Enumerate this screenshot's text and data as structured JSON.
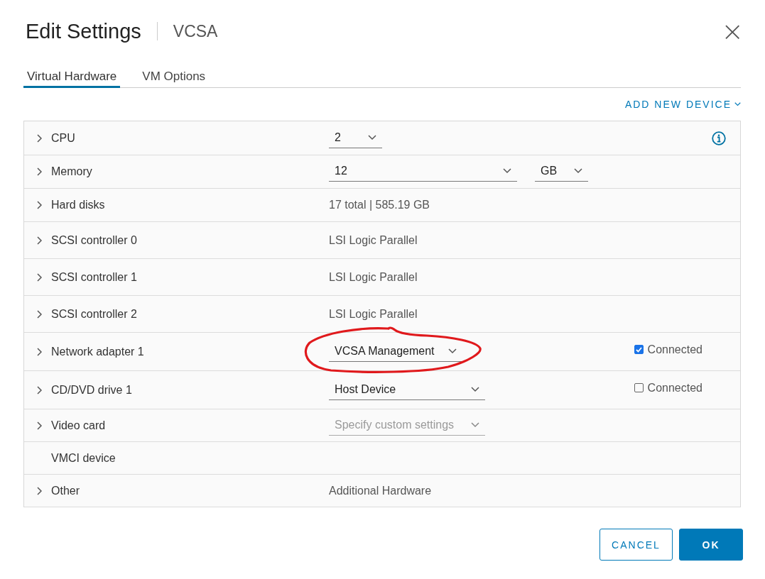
{
  "dialog": {
    "title": "Edit Settings",
    "subtitle": "VCSA",
    "close": "×"
  },
  "tabs": [
    {
      "label": "Virtual Hardware",
      "selected": true
    },
    {
      "label": "VM Options",
      "selected": false
    }
  ],
  "add_device": {
    "label": "ADD NEW DEVICE"
  },
  "rows": [
    {
      "label": "CPU",
      "expandable": true,
      "info": true,
      "controls": [
        {
          "kind": "select",
          "value": "2",
          "disabled": false
        }
      ]
    },
    {
      "label": "Memory",
      "expandable": true,
      "info": false,
      "controls": [
        {
          "kind": "select",
          "value": "12",
          "disabled": false
        },
        {
          "kind": "select",
          "value": "GB",
          "disabled": false
        }
      ]
    },
    {
      "label": "Hard disks",
      "expandable": true,
      "info": false,
      "controls": [
        {
          "kind": "text",
          "value": "17 total | 585.19 GB"
        }
      ]
    },
    {
      "label": "SCSI controller 0",
      "expandable": true,
      "info": false,
      "controls": [
        {
          "kind": "text",
          "value": "LSI Logic Parallel"
        }
      ]
    },
    {
      "label": "SCSI controller 1",
      "expandable": true,
      "info": false,
      "controls": [
        {
          "kind": "text",
          "value": "LSI Logic Parallel"
        }
      ]
    },
    {
      "label": "SCSI controller 2",
      "expandable": true,
      "info": false,
      "controls": [
        {
          "kind": "text",
          "value": "LSI Logic Parallel"
        }
      ]
    },
    {
      "label": "Network adapter 1",
      "expandable": true,
      "info": false,
      "controls": [
        {
          "kind": "select",
          "value": "VCSA Management",
          "disabled": false
        },
        {
          "kind": "checkbox",
          "value": "Connected",
          "checked": true
        }
      ]
    },
    {
      "label": "CD/DVD drive 1",
      "expandable": true,
      "info": false,
      "controls": [
        {
          "kind": "select",
          "value": "Host Device",
          "disabled": false
        },
        {
          "kind": "checkbox",
          "value": "Connected",
          "checked": false
        }
      ]
    },
    {
      "label": "Video card",
      "expandable": true,
      "info": false,
      "controls": [
        {
          "kind": "select",
          "value": "Specify custom settings",
          "disabled": true
        }
      ]
    },
    {
      "label": "VMCI device",
      "expandable": false,
      "info": false,
      "controls": []
    },
    {
      "label": "Other",
      "expandable": true,
      "info": false,
      "controls": [
        {
          "kind": "text",
          "value": "Additional Hardware"
        }
      ]
    }
  ],
  "buttons": [
    {
      "label": "CANCEL",
      "kind": "secondary"
    },
    {
      "label": "OK",
      "kind": "primary"
    }
  ]
}
